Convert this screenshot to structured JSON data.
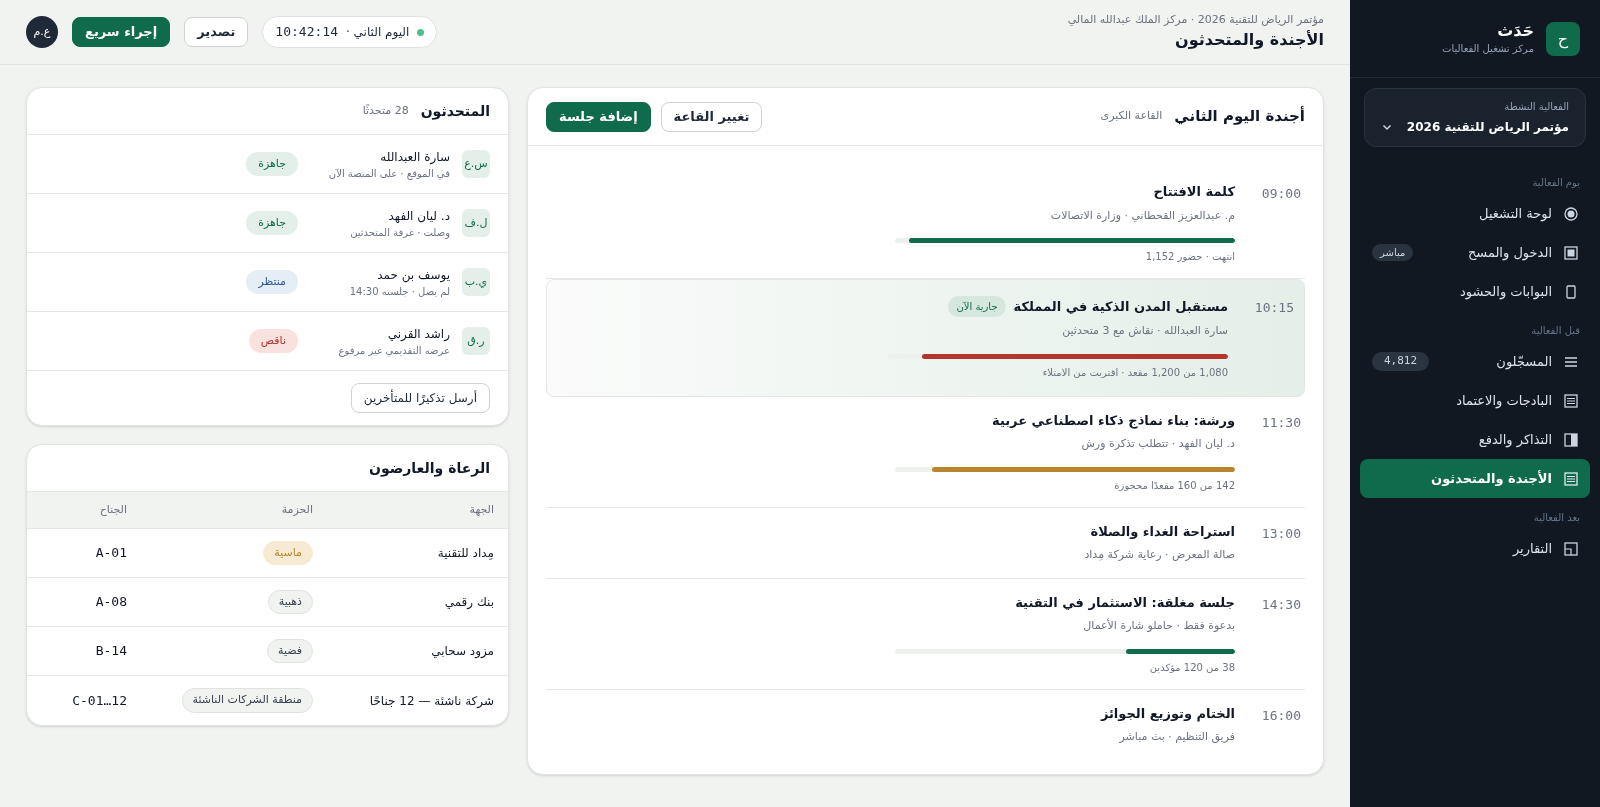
{
  "sidebar": {
    "logo_letter": "ح",
    "app_name": "حَدَث",
    "app_subtitle": "مركز تشغيل الفعاليات",
    "event_picker": {
      "label": "الفعالية النشطة",
      "value": "مؤتمر الرياض للتقنية 2026"
    },
    "groups": [
      {
        "title": "يوم الفعالية",
        "items": [
          {
            "label": "لوحة التشغيل",
            "selected": false
          },
          {
            "label": "الدخول والمسح",
            "selected": false,
            "badge": "مباشر",
            "kind": "live"
          },
          {
            "label": "البوابات والحشود",
            "selected": false
          }
        ]
      },
      {
        "title": "قبل الفعالية",
        "items": [
          {
            "label": "المسجّلون",
            "selected": false,
            "badge": "4,812",
            "kind": "count"
          },
          {
            "label": "البادجات والاعتماد",
            "selected": false
          },
          {
            "label": "التذاكر والدفع",
            "selected": false
          },
          {
            "label": "الأجندة والمتحدثون",
            "selected": true
          }
        ]
      },
      {
        "title": "بعد الفعالية",
        "items": [
          {
            "label": "التقارير",
            "selected": false
          }
        ]
      }
    ]
  },
  "header": {
    "breadcrumb": "مؤتمر الرياض للتقنية 2026 · مركز الملك عبدالله المالي",
    "title": "الأجندة والمتحدثون",
    "day": "اليوم الثاني ·",
    "clock": "10:42:14",
    "live": true,
    "buttons": [
      {
        "label": "تصدير",
        "kind": "outline"
      },
      {
        "label": "إجراء سريع",
        "kind": "primary"
      }
    ],
    "avatar": "ع.م"
  },
  "agenda": {
    "title": "أجندة اليوم الثاني",
    "hall": "القاعة الكبرى",
    "buttons": [
      {
        "label": "تغيير القاعة",
        "kind": "outline"
      },
      {
        "label": "إضافة جلسة",
        "kind": "primary"
      }
    ],
    "sessions": [
      {
        "time": "09:00",
        "title": "كلمة الافتتاح",
        "subtitle": "م. عبدالعزيز القحطاني · وزارة الاتصالات",
        "current": false,
        "level": 0.96,
        "color": "#106b4c",
        "note": "انتهت · حضور 1,152"
      },
      {
        "time": "10:15",
        "title": "مستقبل المدن الذكية في المملكة",
        "subtitle": "سارة العبدالله · نقاش مع 3 متحدثين",
        "current": true,
        "badge": "جارية الآن",
        "level": 0.9,
        "color": "#b3352b",
        "note": "1,080 من 1,200 مقعد · اقتربت من الامتلاء"
      },
      {
        "time": "11:30",
        "title": "ورشة: بناء نماذج ذكاء اصطناعي عربية",
        "subtitle": "د. ليان الفهد · تتطلب تذكرة ورش",
        "current": false,
        "level": 0.89,
        "color": "#b8862f",
        "note": "142 من 160 مقعدًا محجوزة"
      },
      {
        "time": "13:00",
        "title": "استراحة الغداء والصلاة",
        "subtitle": "صالة المعرض · رعاية شركة مِداد",
        "current": false
      },
      {
        "time": "14:30",
        "title": "جلسة مغلقة: الاستثمار في التقنية",
        "subtitle": "بدعوة فقط · حاملو شارة الأعمال",
        "current": false,
        "level": 0.32,
        "color": "#106b4c",
        "note": "38 من 120 مؤكدين"
      },
      {
        "time": "16:00",
        "title": "الختام وتوزيع الجوائز",
        "subtitle": "فريق التنظيم · بث مباشر",
        "current": false
      }
    ]
  },
  "speakers": {
    "title": "المتحدثون",
    "count": "28 متحدثًا",
    "rows": [
      {
        "initials": "س.ع",
        "name": "سارة العبدالله",
        "detail": "في الموقع · على المنصة الآن",
        "status": "جاهزة",
        "kind": "ready"
      },
      {
        "initials": "ل.ف",
        "name": "د. ليان الفهد",
        "detail": "وصلت · غرفة المتحدثين",
        "status": "جاهزة",
        "kind": "ready"
      },
      {
        "initials": "ي.ب",
        "name": "يوسف بن حمد",
        "detail": "لم يصل · جلسته 14:30",
        "status": "منتظر",
        "kind": "waiting"
      },
      {
        "initials": "ر.ق",
        "name": "راشد القرني",
        "detail": "عرضه التقديمي غير مرفوع",
        "status": "ناقص",
        "kind": "missing"
      }
    ],
    "action": "أرسل تذكيرًا للمتأخرين"
  },
  "sponsors": {
    "title": "الرعاة والعارضون",
    "columns": [
      "الجهة",
      "الحزمة",
      "الجناح"
    ],
    "rows": [
      {
        "name": "مِداد للتقنية",
        "tier": "ماسية",
        "kind": "diamond",
        "booth": "A-01"
      },
      {
        "name": "بنك رقمي",
        "tier": "ذهبية",
        "kind": "standard",
        "booth": "A-08"
      },
      {
        "name": "مزود سحابي",
        "tier": "فضية",
        "kind": "standard",
        "booth": "B-14"
      },
      {
        "name": "شركة ناشئة — 12 جناحًا",
        "tier": "منطقة الشركات الناشئة",
        "kind": "standard",
        "booth": "C-01…12"
      }
    ]
  }
}
